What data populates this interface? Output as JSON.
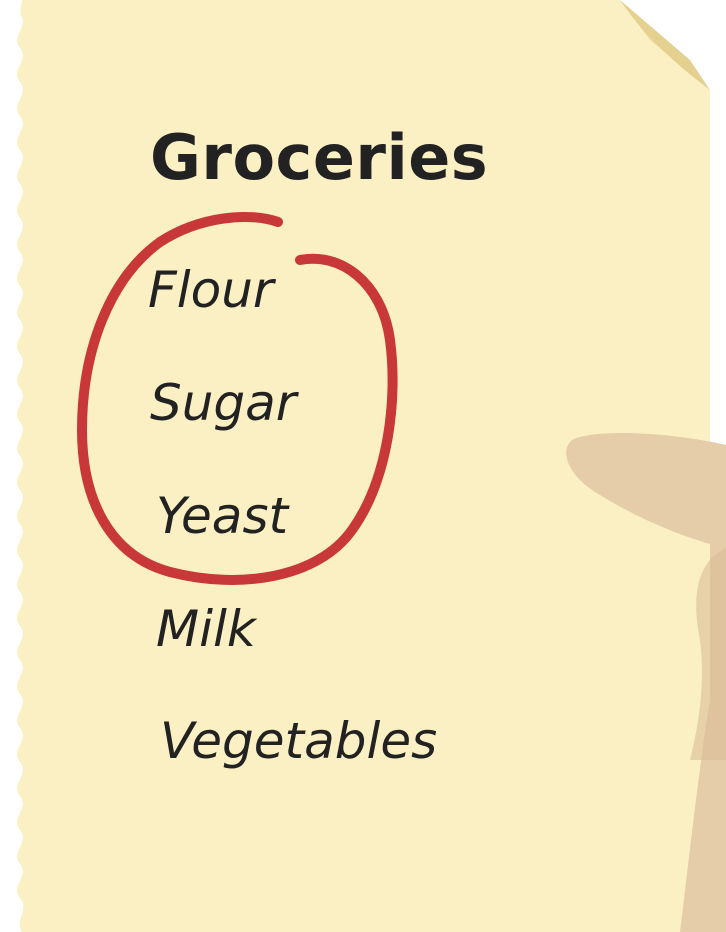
{
  "note": {
    "title": "Groceries",
    "items": [
      "Flour",
      "Sugar",
      "Yeast",
      "Milk",
      "Vegetables"
    ]
  },
  "circled_items": [
    "Flour",
    "Sugar",
    "Yeast"
  ],
  "colors": {
    "paper": "#fbf0c4",
    "paper_fold": "#ecdc9f",
    "hand": "#e6cda9",
    "hand_shadow": "#d8bd97",
    "text": "#222222",
    "circle": "#c8373a"
  },
  "icons": {
    "fold": "page-corner-fold",
    "hand": "holding-hand",
    "circle": "hand-drawn-circle"
  }
}
